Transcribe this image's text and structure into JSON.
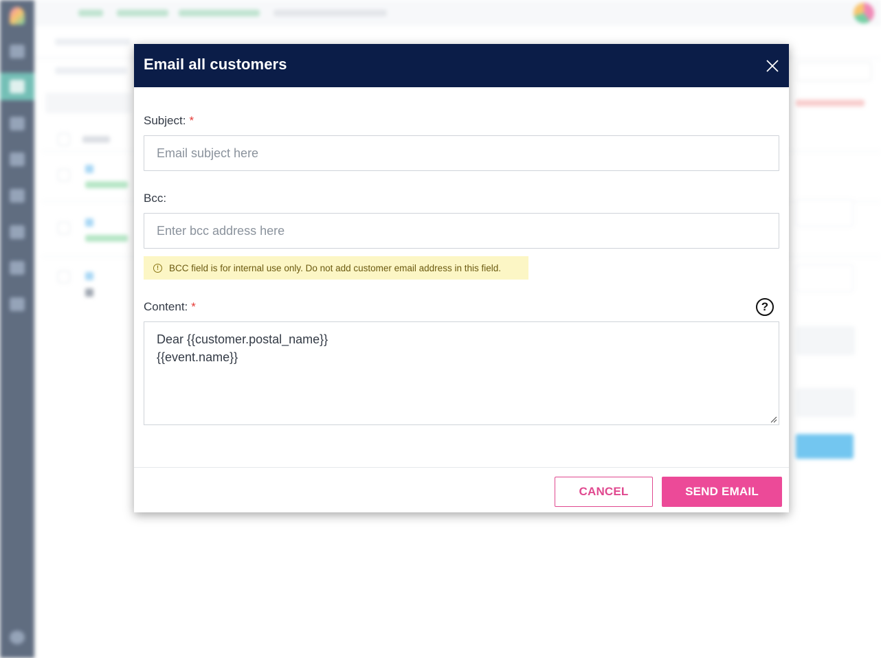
{
  "modal": {
    "title": "Email all customers",
    "subject_label": "Subject:",
    "subject_required_mark": "*",
    "subject_placeholder": "Email subject here",
    "subject_value": "",
    "bcc_label": "Bcc:",
    "bcc_placeholder": "Enter bcc address here",
    "bcc_value": "",
    "bcc_warning": "BCC field is for internal use only. Do not add customer email address in this field.",
    "warning_icon_glyph": "!",
    "content_label": "Content:",
    "content_required_mark": "*",
    "help_icon_glyph": "?",
    "content_lines": [
      "Dear {{customer.postal_name}}",
      "{{event.name}}"
    ],
    "cancel_label": "CANCEL",
    "send_label": "SEND EMAIL"
  },
  "icons": {
    "close": "close-icon",
    "warning": "warning-circle-icon",
    "help": "question-circle-icon",
    "resize": "resize-grip-icon"
  },
  "colors": {
    "header_bg": "#0b1d48",
    "accent_pink": "#ec4a98",
    "warning_bg": "#fcf6c5",
    "required": "#e53935",
    "sidebar_bg": "#0b1f3d"
  }
}
